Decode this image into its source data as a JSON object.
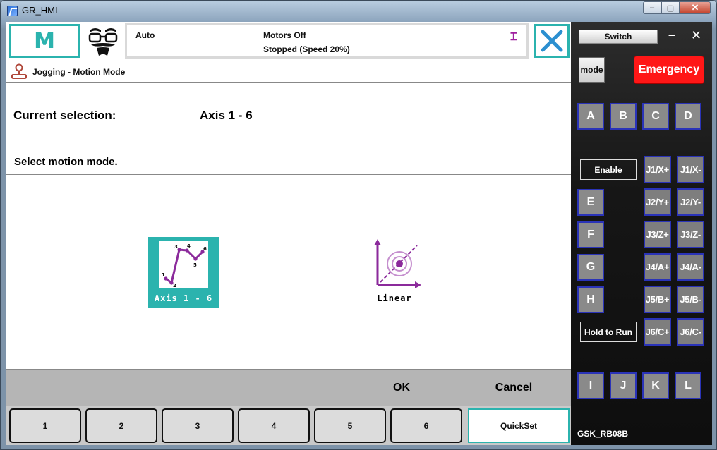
{
  "window": {
    "title": "GR_HMI",
    "controls": [
      "–",
      "▢",
      "✕"
    ]
  },
  "header": {
    "mode_letter": "M",
    "status": {
      "mode": "Auto",
      "motors": "Motors Off",
      "state": "Stopped (Speed 20%)",
      "indicator": "Ɪ"
    }
  },
  "breadcrumb": {
    "text": "Jogging - Motion Mode"
  },
  "selection": {
    "label": "Current selection:",
    "value": "Axis 1 - 6",
    "prompt": "Select motion mode."
  },
  "modes": [
    {
      "label": "Axis 1 - 6",
      "selected": true,
      "point_numbers": [
        "1",
        "2",
        "3",
        "4",
        "5",
        "6"
      ]
    },
    {
      "label": "Linear",
      "selected": false
    }
  ],
  "actions": {
    "ok": "OK",
    "cancel": "Cancel"
  },
  "tabs": [
    "1",
    "2",
    "3",
    "4",
    "5",
    "6",
    "QuickSet"
  ],
  "panel": {
    "switch": "Switch",
    "minimize": "–",
    "close": "✕",
    "mode": "mode",
    "emergency": "Emergency",
    "top_keys": [
      "A",
      "B",
      "C",
      "D"
    ],
    "enable": "Enable",
    "side_keys": [
      "E",
      "F",
      "G",
      "H"
    ],
    "hold_to_run": "Hold to Run",
    "jog_keys": [
      [
        "J1/X+",
        "J1/X-"
      ],
      [
        "J2/Y+",
        "J2/Y-"
      ],
      [
        "J3/Z+",
        "J3/Z-"
      ],
      [
        "J4/A+",
        "J4/A-"
      ],
      [
        "J5/B+",
        "J5/B-"
      ],
      [
        "J6/C+",
        "J6/C-"
      ]
    ],
    "bottom_keys": [
      "I",
      "J",
      "K",
      "L"
    ],
    "model": "GSK_RB08B"
  },
  "colors": {
    "accent": "#2bb3ae",
    "emergency": "#ff1717",
    "key_border": "#2a33b8",
    "icon_purple": "#8b2a9b"
  }
}
